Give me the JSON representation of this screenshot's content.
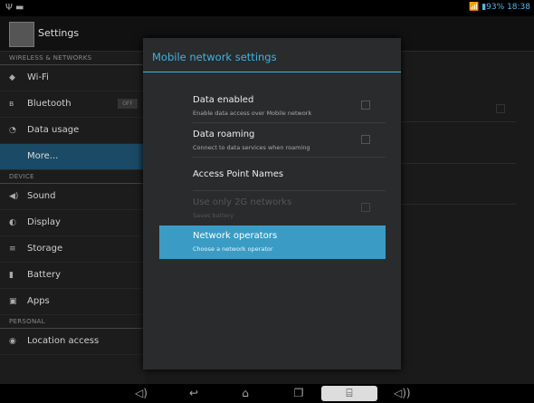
{
  "status": {
    "left_icons": "Ψ ▬",
    "battery": "93%",
    "time": "18:38"
  },
  "actionbar": {
    "title": "Settings"
  },
  "sidebar": {
    "sections": {
      "wireless": "WIRELESS & NETWORKS",
      "device": "DEVICE",
      "personal": "PERSONAL"
    },
    "items": {
      "wifi": "Wi-Fi",
      "bluetooth": "Bluetooth",
      "bluetooth_toggle": "OFF",
      "data_usage": "Data usage",
      "more": "More...",
      "sound": "Sound",
      "display": "Display",
      "storage": "Storage",
      "battery": "Battery",
      "apps": "Apps",
      "location": "Location access"
    }
  },
  "dialog": {
    "title": "Mobile network settings",
    "options": [
      {
        "title": "Data enabled",
        "summary": "Enable data access over Mobile network"
      },
      {
        "title": "Data roaming",
        "summary": "Connect to data services when roaming"
      },
      {
        "title": "Access Point Names"
      },
      {
        "title": "Use only 2G networks",
        "summary": "Saves battery"
      },
      {
        "title": "Network operators",
        "summary": "Choose a network operator"
      }
    ]
  },
  "navbar": {
    "icons": [
      "volume-down-icon",
      "back-icon",
      "home-icon",
      "recent-apps-icon",
      "screenshot-icon",
      "volume-up-icon"
    ]
  }
}
